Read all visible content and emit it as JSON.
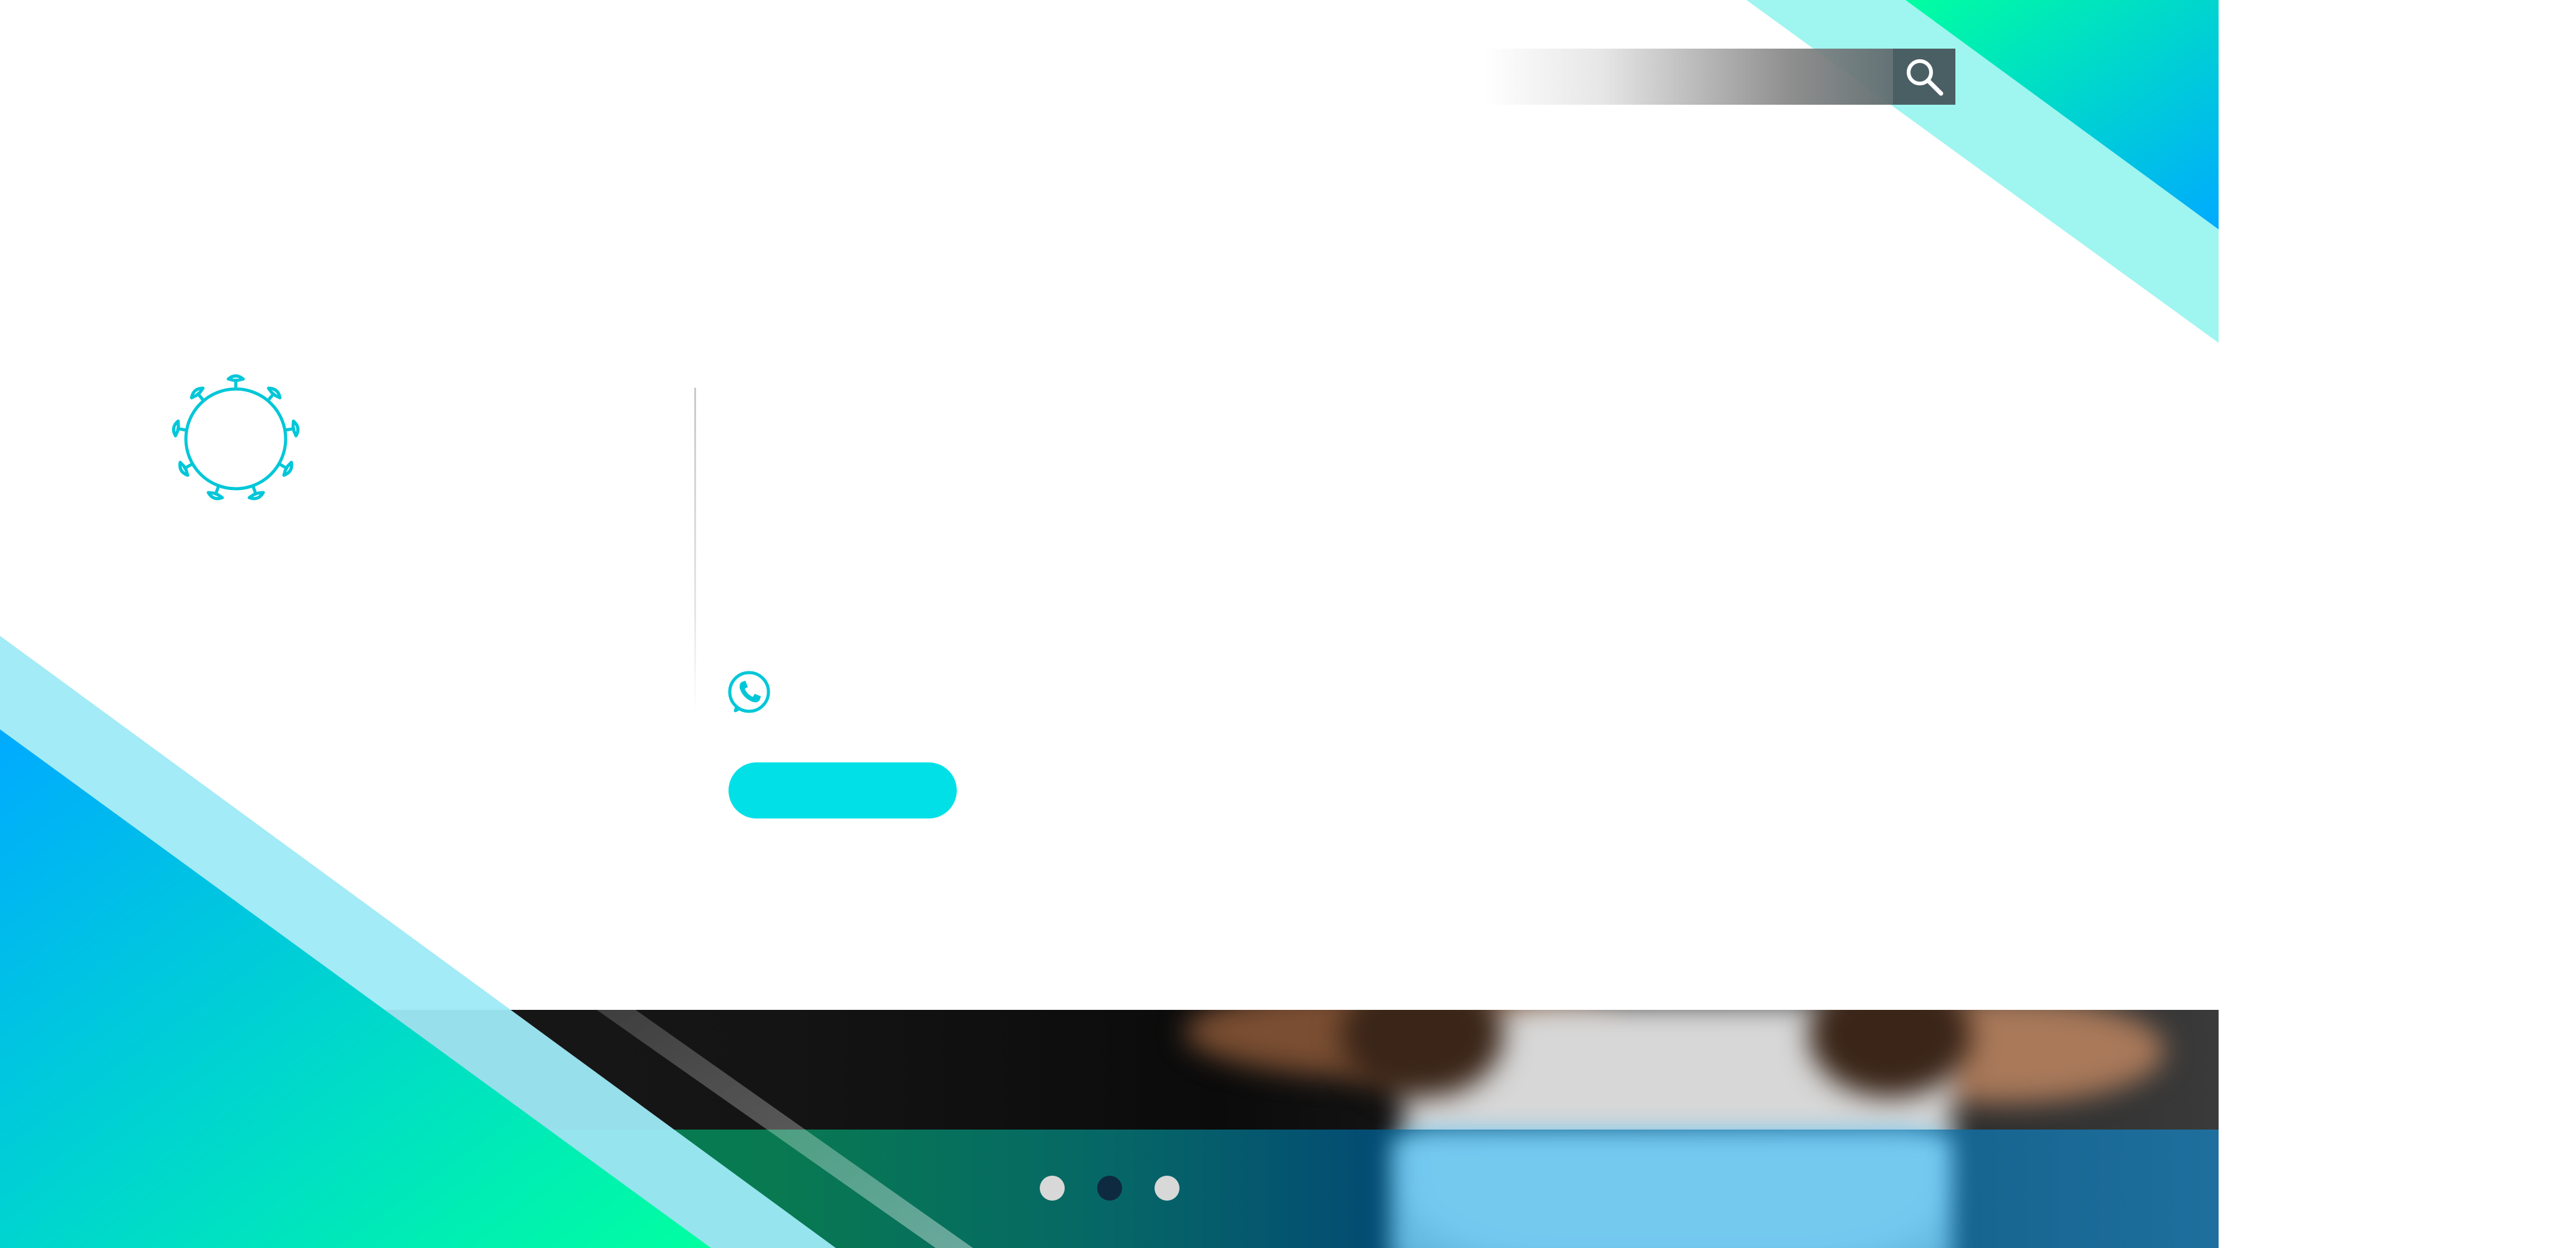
{
  "search": {
    "placeholder": "",
    "value": "",
    "icon": "search-icon"
  },
  "header": {
    "logo_icon": "virus-icon",
    "logo_text": ""
  },
  "hero": {
    "headline": "",
    "phone_icon": "phone-icon",
    "phone_number": "",
    "cta_label": ""
  },
  "slider": {
    "dot_count": 3,
    "active_index": 1
  },
  "colors": {
    "accent": "#00e0e6",
    "accent_stroke": "#00c7d8",
    "deco_blue": "#00aaff",
    "deco_green": "#00ffa0",
    "deco_light": "#9ff5f0",
    "search_dark": "#4a5f63",
    "dot_active": "#0e2a40",
    "dot_inactive": "#d8d8d8"
  }
}
